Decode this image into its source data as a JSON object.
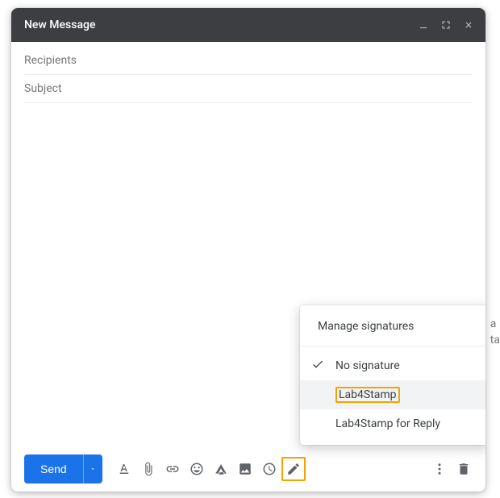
{
  "header": {
    "title": "New Message"
  },
  "fields": {
    "recipients_placeholder": "Recipients",
    "subject_placeholder": "Subject"
  },
  "toolbar": {
    "send_label": "Send"
  },
  "signature_menu": {
    "manage": "Manage signatures",
    "no_sig": "No signature",
    "opt1": "Lab4Stamp",
    "opt2": "Lab4Stamp for Reply"
  },
  "bg": {
    "l1": "a",
    "l2": "ta"
  }
}
